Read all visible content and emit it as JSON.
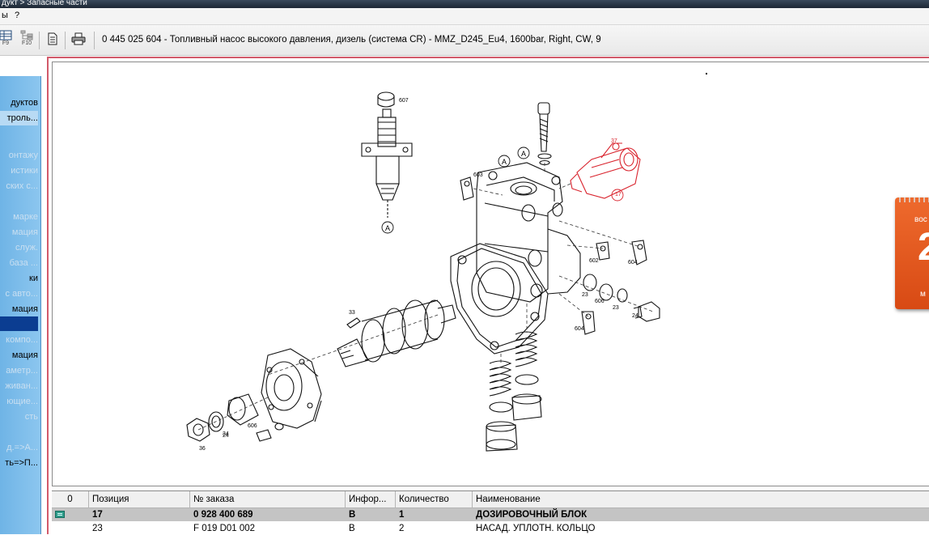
{
  "window": {
    "breadcrumb": "дукт  > Запасные части"
  },
  "menu": {
    "items": [
      "ы",
      "?"
    ]
  },
  "toolbar": {
    "f9_label": "F9",
    "f10_label": "F10",
    "document_title": "0 445 025 604 - Топливный насос высокого давления, дизель (система CR) - MMZ_D245_Eu4, 1600bar, Right, CW, 9"
  },
  "sidebar": {
    "items": [
      {
        "label": "дуктов",
        "style": "dark"
      },
      {
        "label": "троль...",
        "style": "dark-lightsel"
      },
      {
        "label": "онтажу",
        "style": "light"
      },
      {
        "label": "истики",
        "style": "light"
      },
      {
        "label": "ских с...",
        "style": "light"
      },
      {
        "label": "марке",
        "style": "light"
      },
      {
        "label": "мация",
        "style": "light"
      },
      {
        "label": "служ.",
        "style": "light"
      },
      {
        "label": "база ...",
        "style": "light"
      },
      {
        "label": "ки",
        "style": "dark"
      },
      {
        "label": "с авто...",
        "style": "light"
      },
      {
        "label": "мация",
        "style": "dark"
      },
      {
        "label": "",
        "style": "selected"
      },
      {
        "label": "компо...",
        "style": "light"
      },
      {
        "label": "мация",
        "style": "dark"
      },
      {
        "label": "аметр...",
        "style": "light"
      },
      {
        "label": "живан...",
        "style": "light"
      },
      {
        "label": "ющие...",
        "style": "light"
      },
      {
        "label": "сть",
        "style": "light"
      },
      {
        "label": "д.=>А...",
        "style": "light"
      },
      {
        "label": "ть=>П...",
        "style": "dark"
      }
    ]
  },
  "diagram": {
    "callouts": {
      "c607": "607",
      "cA1": "A",
      "cA2": "A",
      "cA3": "A",
      "c17": "17",
      "c37": "37",
      "c603": "603",
      "c602": "602",
      "c604a": "604",
      "c604b": "604",
      "c23a": "23",
      "c23b": "23",
      "c606a": "606",
      "c606b": "606",
      "c24a": "24",
      "c24b": "24",
      "c33": "33",
      "c36": "36",
      "c34": "34"
    }
  },
  "grid": {
    "headers": [
      "0",
      "Позиция",
      "№ заказа",
      "Инфор...",
      "Количество",
      "Наименование"
    ],
    "rows": [
      {
        "position": "17",
        "order_no": "0 928 400 689",
        "info": "B",
        "qty": "1",
        "name": "ДОЗИРОВОЧНЫЙ БЛОК",
        "selected": true
      },
      {
        "position": "23",
        "order_no": "F 019 D01 002",
        "info": "B",
        "qty": "2",
        "name": "НАСАД. УПЛОТН. КОЛЬЦО",
        "selected": false
      }
    ]
  },
  "calendar": {
    "day_label": "вос",
    "day_number": "2",
    "month_label": "м"
  },
  "colors": {
    "sidebar": "#8cc6ef",
    "selection": "#0b3d91",
    "frame": "#d25a6a",
    "highlight_part": "#d9232d",
    "calendar": "#e85c20"
  }
}
